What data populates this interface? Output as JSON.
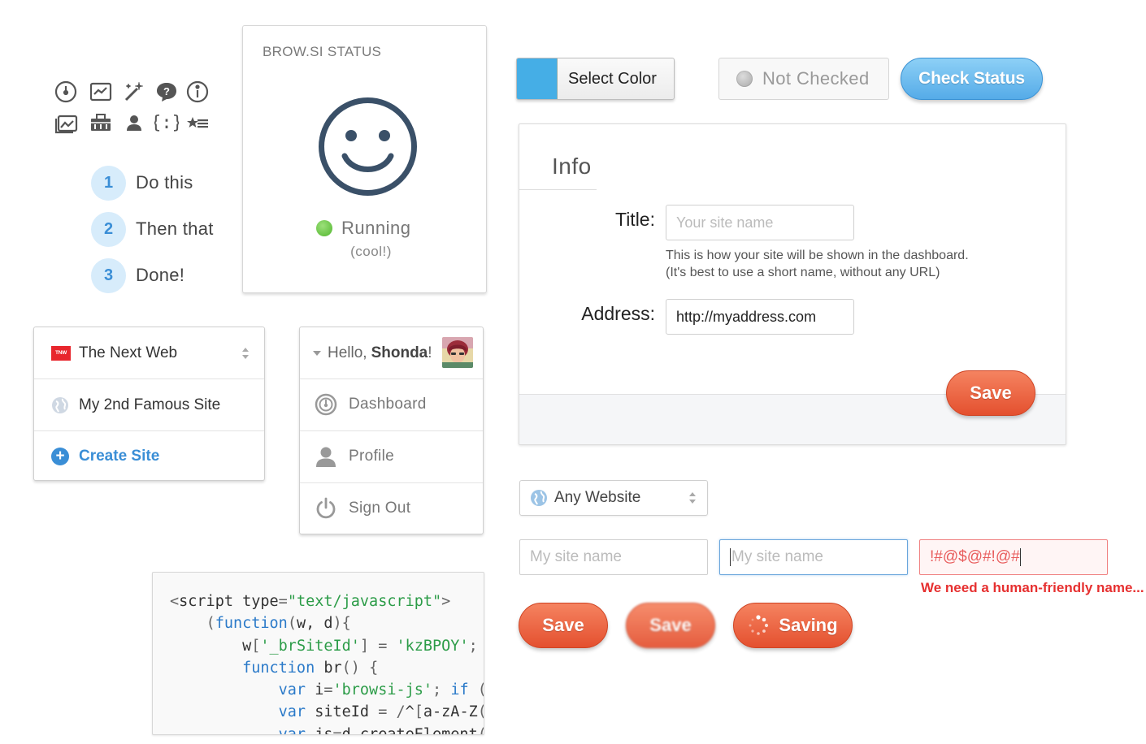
{
  "icon_grid": {
    "icons": [
      "dashboard-gauge-icon",
      "chart-window-icon",
      "magic-wand-icon",
      "help-bubble-icon",
      "info-icon",
      "gallery-icon",
      "toolbox-icon",
      "user-icon",
      "code-braces-icon",
      "star-list-icon"
    ]
  },
  "steps": [
    {
      "num": "1",
      "label": "Do this"
    },
    {
      "num": "2",
      "label": "Then that"
    },
    {
      "num": "3",
      "label": "Done!"
    }
  ],
  "status_card": {
    "title": "BROW.SI STATUS",
    "state": "Running",
    "note": "(cool!)",
    "status_color": "#52b62f"
  },
  "sites_menu": {
    "items": [
      {
        "label": "The Next Web",
        "badge": "TNW"
      },
      {
        "label": "My 2nd Famous Site"
      }
    ],
    "create_label": "Create Site"
  },
  "user_menu": {
    "greeting": "Hello,",
    "name": "Shonda",
    "bang": "!",
    "items": [
      {
        "label": "Dashboard",
        "icon": "dashboard-icon"
      },
      {
        "label": "Profile",
        "icon": "profile-icon"
      },
      {
        "label": "Sign Out",
        "icon": "power-icon"
      }
    ]
  },
  "code_snippet": {
    "lines": [
      "<script type=\"text/javascript\">",
      "    (function(w, d){",
      "        w['_brSiteId'] = 'kzBPOY';",
      "        function br() {",
      "            var i='browsi-js'; if (",
      "            var siteId = /^[a-zA-Z(",
      "            var js=d.createElement("
    ]
  },
  "top_controls": {
    "select_color_label": "Select Color",
    "swatch_color": "#45aee6",
    "not_checked_label": "Not Checked",
    "check_status_label": "Check Status"
  },
  "info_panel": {
    "title": "Info",
    "title_label": "Title:",
    "title_placeholder": "Your site name",
    "help_line1": "This is how your site will be shown in the dashboard.",
    "help_line2": "(It's best to use a short name, without any URL)",
    "address_label": "Address:",
    "address_value": "http://myaddress.com",
    "save_label": "Save"
  },
  "site_filter": {
    "selected": "Any Website"
  },
  "input_states": {
    "normal_placeholder": "My site name",
    "focus_placeholder": "My site name",
    "error_value": "!#@$@#!@#",
    "error_message": "We need a human-friendly name..."
  },
  "buttons": {
    "save_label": "Save",
    "save_pressed_label": "Save",
    "saving_label": "Saving"
  },
  "colors": {
    "accent_blue": "#3a8ed6",
    "save_orange": "#e4502f",
    "error_red": "#e63030"
  }
}
